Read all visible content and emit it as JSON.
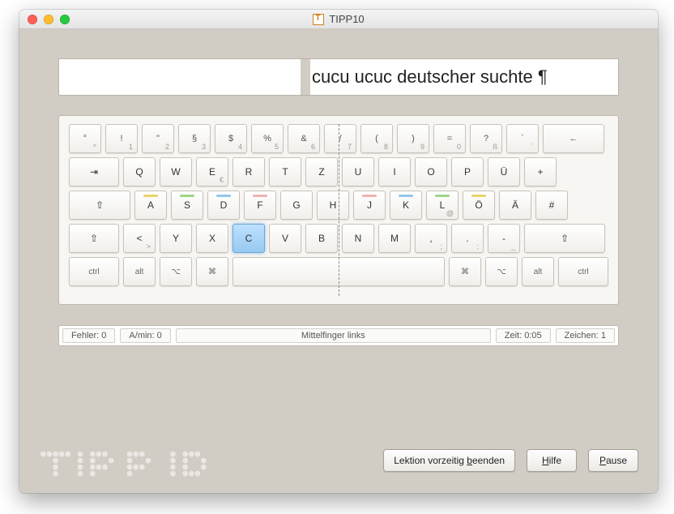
{
  "window": {
    "title": "TIPP10"
  },
  "typing": {
    "text": "cucu ucuc deutscher suchte ¶"
  },
  "keyboard": {
    "row1": [
      "°",
      "!",
      "\"",
      "§",
      "$",
      "%",
      "&",
      "/",
      "(",
      ")",
      "=",
      "?",
      "`",
      "←"
    ],
    "row1sub": [
      "^",
      "1",
      "2",
      "3",
      "4",
      "5",
      "6",
      "7",
      "8",
      "9",
      "0",
      "ß",
      "´",
      ""
    ],
    "row2": [
      "⇥",
      "Q",
      "W",
      "E",
      "R",
      "T",
      "Z",
      "U",
      "I",
      "O",
      "P",
      "Ü",
      "+"
    ],
    "row2sub": [
      "",
      "",
      "",
      "€",
      "",
      "",
      "",
      "",
      "",
      "",
      "",
      "",
      ""
    ],
    "row3": [
      "⇧",
      "A",
      "S",
      "D",
      "F",
      "G",
      "H",
      "J",
      "K",
      "L",
      "Ö",
      "Ä",
      "#"
    ],
    "row3sub": [
      "",
      "",
      "",
      "",
      "",
      "",
      "",
      "",
      "",
      "@",
      "",
      "",
      ""
    ],
    "row4": [
      "⇧",
      "<",
      "Y",
      "X",
      "C",
      "V",
      "B",
      "N",
      "M",
      ",",
      ".",
      "-",
      "⇧"
    ],
    "row4sub": [
      "",
      ">",
      "",
      "",
      "",
      "",
      "",
      "",
      "",
      ";",
      ":",
      "_",
      ""
    ],
    "row5": [
      "ctrl",
      "alt",
      "⌥",
      "⌘",
      "",
      "⌘",
      "⌥",
      "alt",
      "ctrl"
    ],
    "highlighted_key": "C"
  },
  "status": {
    "errors": "Fehler: 0",
    "speed": "A/min: 0",
    "hint": "Mittelfinger links",
    "time": "Zeit: 0:05",
    "chars": "Zeichen: 1"
  },
  "buttons": {
    "end": "Lektion vorzeitig beenden",
    "help": "Hilfe",
    "pause": "Pause"
  },
  "logo_ascii": "●●●●● ● ●●●   ●●●    ● ●●●\n  ●   ● ●  ●  ●  ●   ● ●  ●\n  ●   ● ●●●   ●●●    ● ●  ●\n  ●   ● ●     ●      ● ●●●"
}
